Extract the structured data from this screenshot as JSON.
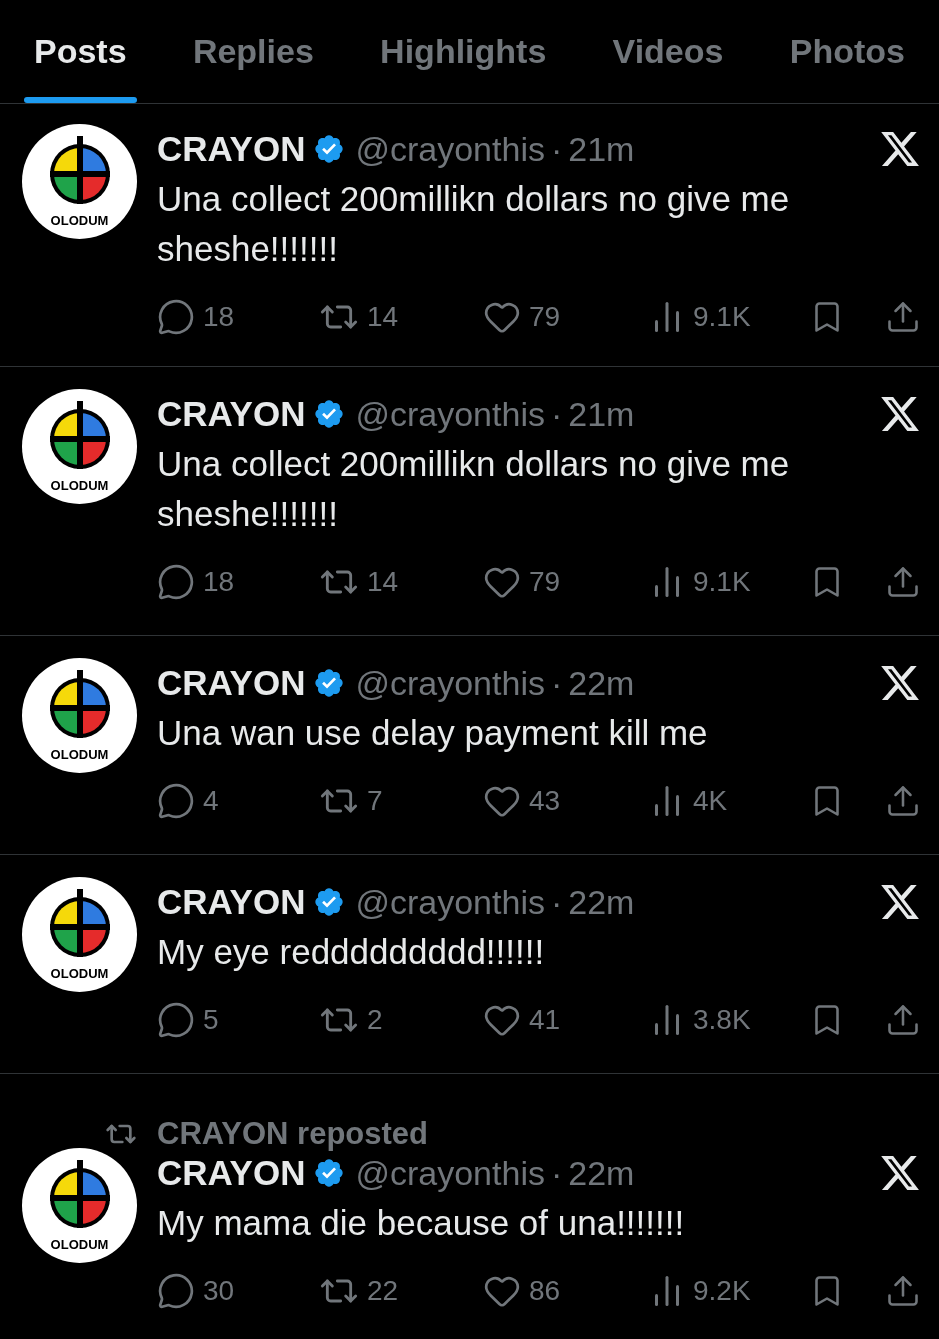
{
  "tabs": [
    {
      "label": "Posts",
      "selected": true
    },
    {
      "label": "Replies",
      "selected": false
    },
    {
      "label": "Highlights",
      "selected": false
    },
    {
      "label": "Videos",
      "selected": false
    },
    {
      "label": "Photos",
      "selected": false
    }
  ],
  "posts": [
    {
      "avatar_label": "OLODUM",
      "name": "CRAYON",
      "verified": true,
      "handle": "@crayonthis",
      "separator": "·",
      "time": "21m",
      "text": "Una collect 200millikn dollars no give me sheshe!!!!!!!",
      "replies": "18",
      "reposts": "14",
      "likes": "79",
      "views": "9.1K"
    },
    {
      "avatar_label": "OLODUM",
      "name": "CRAYON",
      "verified": true,
      "handle": "@crayonthis",
      "separator": "·",
      "time": "21m",
      "text": "Una collect 200millikn dollars no give me sheshe!!!!!!!",
      "replies": "18",
      "reposts": "14",
      "likes": "79",
      "views": "9.1K"
    },
    {
      "avatar_label": "OLODUM",
      "name": "CRAYON",
      "verified": true,
      "handle": "@crayonthis",
      "separator": "·",
      "time": "22m",
      "text": "Una wan use delay payment kill me",
      "replies": "4",
      "reposts": "7",
      "likes": "43",
      "views": "4K"
    },
    {
      "avatar_label": "OLODUM",
      "name": "CRAYON",
      "verified": true,
      "handle": "@crayonthis",
      "separator": "·",
      "time": "22m",
      "text": "My eye reddddddddd!!!!!!",
      "replies": "5",
      "reposts": "2",
      "likes": "41",
      "views": "3.8K"
    },
    {
      "reposted_by": "CRAYON reposted",
      "avatar_label": "OLODUM",
      "name": "CRAYON",
      "verified": true,
      "handle": "@crayonthis",
      "separator": "·",
      "time": "22m",
      "text": "My mama die because of una!!!!!!!",
      "replies": "30",
      "reposts": "22",
      "likes": "86",
      "views": "9.2K"
    }
  ]
}
